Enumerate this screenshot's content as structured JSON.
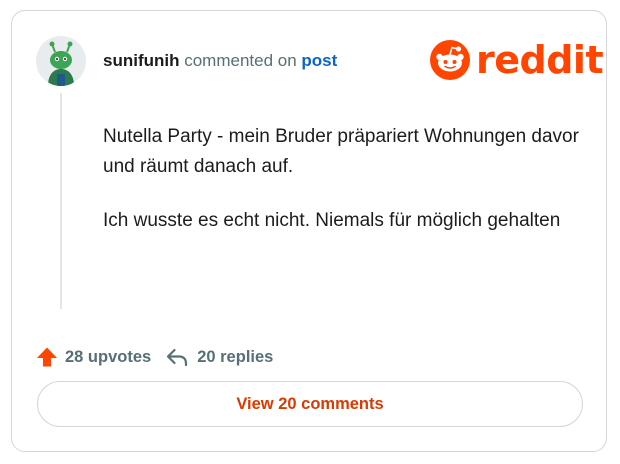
{
  "comment": {
    "username": "sunifunih",
    "action_text": "commented on",
    "target_link": "post",
    "paragraphs": [
      "Nutella Party - mein Bruder präpariert Wohnungen davor und räumt danach auf.",
      "Ich wusste es echt nicht. Niemals für möglich gehalten"
    ]
  },
  "brand": {
    "wordmark": "reddit",
    "color": "#ff4500",
    "icon": "reddit-snoo-icon"
  },
  "stats": {
    "upvotes_label": "28 upvotes",
    "upvote_icon": "upvote-arrow-icon",
    "upvote_color": "#ff4500",
    "replies_label": "20 replies",
    "reply_icon": "reply-arrow-icon"
  },
  "footer": {
    "view_comments_label": "View 20 comments"
  }
}
